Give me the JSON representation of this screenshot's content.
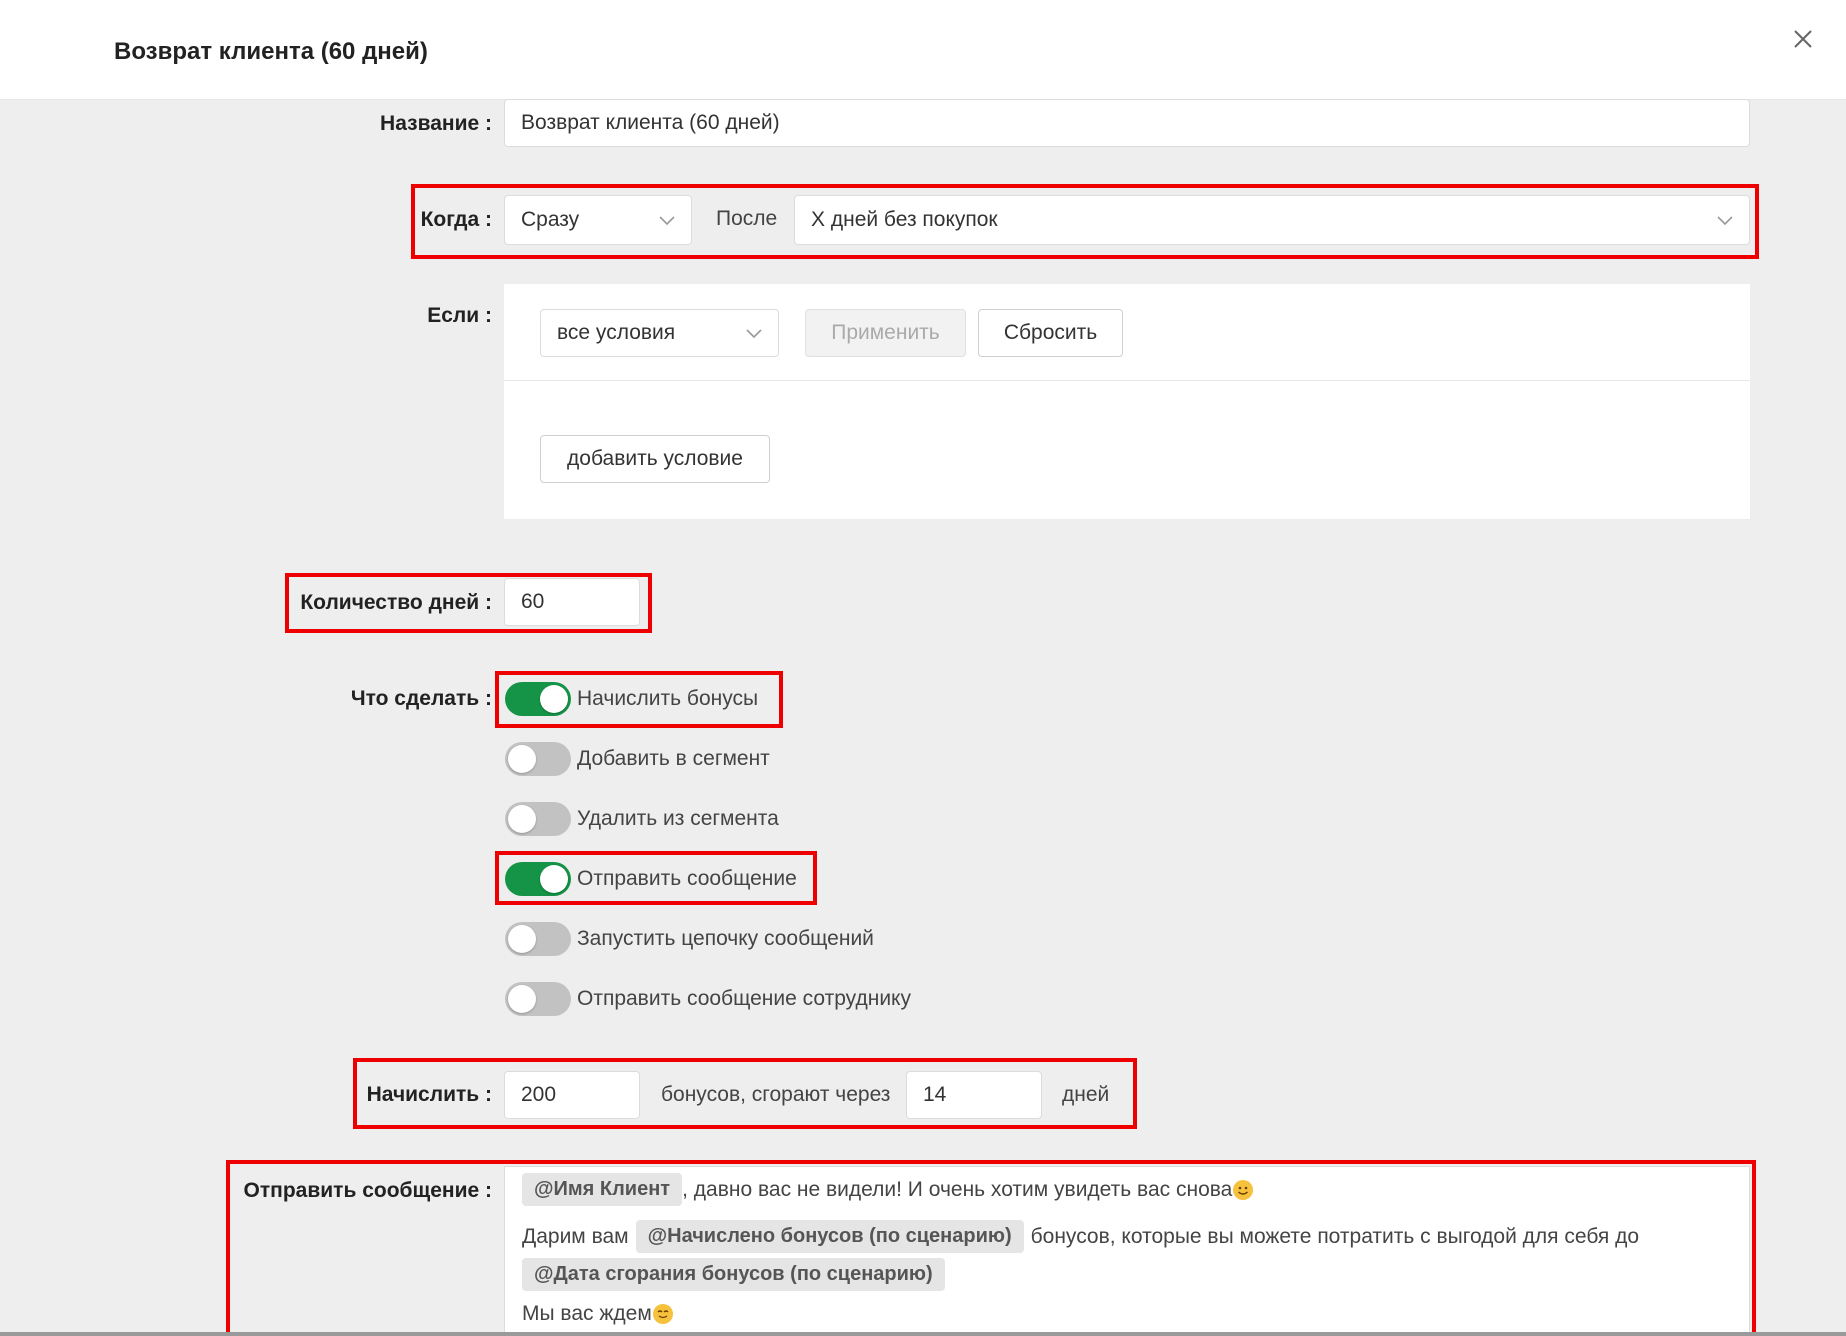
{
  "dialog": {
    "title": "Возврат клиента (60 дней)"
  },
  "form": {
    "name": {
      "label": "Название",
      "value": "Возврат клиента (60 дней)"
    },
    "when": {
      "label": "Когда",
      "timing_value": "Сразу",
      "after_label": "После",
      "event_value": "Х дней без покупок"
    },
    "if": {
      "label": "Если",
      "conditions_value": "все условия",
      "apply_label": "Применить",
      "reset_label": "Сбросить",
      "add_condition_label": "добавить условие"
    },
    "days": {
      "label": "Количество дней",
      "value": "60"
    },
    "actions": {
      "label": "Что сделать",
      "items": [
        {
          "label": "Начислить бонусы",
          "on": true
        },
        {
          "label": "Добавить в сегмент",
          "on": false
        },
        {
          "label": "Удалить из сегмента",
          "on": false
        },
        {
          "label": "Отправить сообщение",
          "on": true
        },
        {
          "label": "Запустить цепочку сообщений",
          "on": false
        },
        {
          "label": "Отправить сообщение сотруднику",
          "on": false
        }
      ]
    },
    "accrue": {
      "label": "Начислить",
      "amount_value": "200",
      "middle_text": "бонусов, сгорают через",
      "days_value": "14",
      "suffix_text": "дней"
    },
    "message": {
      "label": "Отправить сообщение",
      "line1_tag": "@Имя Клиент",
      "line1_text": ", давно вас не видели! И очень хотим увидеть вас снова",
      "line2_text_a": "Дарим вам",
      "line2_tag": "@Начислено бонусов (по сценарию)",
      "line2_text_b": "бонусов, которые вы можете потратить с выгодой для себя до",
      "line3_tag": "@Дата сгорания бонусов (по сценарию)",
      "line4_text": "Мы вас ждем"
    }
  },
  "colors": {
    "toggle_on": "#159447",
    "toggle_off": "#c2c2c2",
    "highlight": "#ee0000",
    "background": "#eeeeee"
  }
}
